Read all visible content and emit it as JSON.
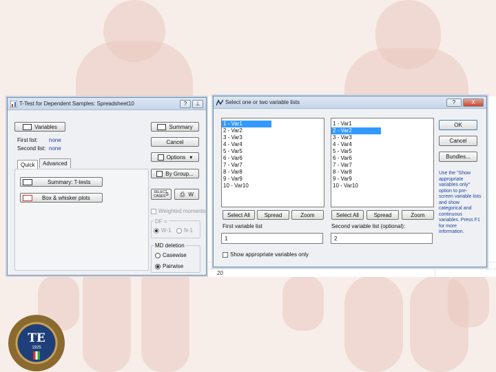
{
  "left_dialog": {
    "title": "T-Test for Dependent Samples: Spreadsheet10",
    "help": "?",
    "variables_btn": "Variables",
    "first_list_label": "First list:",
    "first_list_value": "none",
    "second_list_label": "Second list:",
    "second_list_value": "none",
    "tabs": [
      "Quick",
      "Advanced"
    ],
    "summary_ttests": "Summary: T-tests",
    "box_whisker": "Box & whisker plots",
    "summary_btn": "Summary",
    "cancel_btn": "Cancel",
    "options_btn": "Options",
    "bygroup_btn": "By Group...",
    "select_cases": "SELECT CASES",
    "s_label": "S",
    "w_label": "W",
    "weighted_moments": "Weighted moments",
    "df_label": "DF =",
    "df_opt1": "W-1",
    "df_opt2": "N-1",
    "md_label": "MD deletion",
    "md_opt1": "Casewise",
    "md_opt2": "Pairwise"
  },
  "right_dialog": {
    "title": "Select one or two variable lists",
    "help": "?",
    "close": "X",
    "list1": [
      "1 - Var1",
      "2 - Var2",
      "3 - Var3",
      "4 - Var4",
      "5 - Var5",
      "6 - Var6",
      "7 - Var7",
      "8 - Var8",
      "9 - Var9",
      "10 - Var10"
    ],
    "list2": [
      "1 - Var1",
      "2 - Var2",
      "3 - Var3",
      "4 - Var4",
      "5 - Var5",
      "6 - Var6",
      "7 - Var7",
      "8 - Var8",
      "9 - Var9",
      "10 - Var10"
    ],
    "list1_selected": 0,
    "list2_selected": 1,
    "select_all": "Select All",
    "spread": "Spread",
    "zoom": "Zoom",
    "first_label": "First variable list",
    "first_value": "1",
    "second_label": "Second variable list (optional):",
    "second_value": "2",
    "show_appropriate": "Show appropriate variables only",
    "ok": "OK",
    "cancel": "Cancel",
    "bundles": "Bundles...",
    "help_text": "Use the \"Show appropriate variables only\" option to pre-screen variable lists and show categorical and continuous variables. Press F1 for more information."
  },
  "sheet": {
    "row_label": "20"
  },
  "logo": {
    "initials": "TE",
    "year": "1925"
  }
}
